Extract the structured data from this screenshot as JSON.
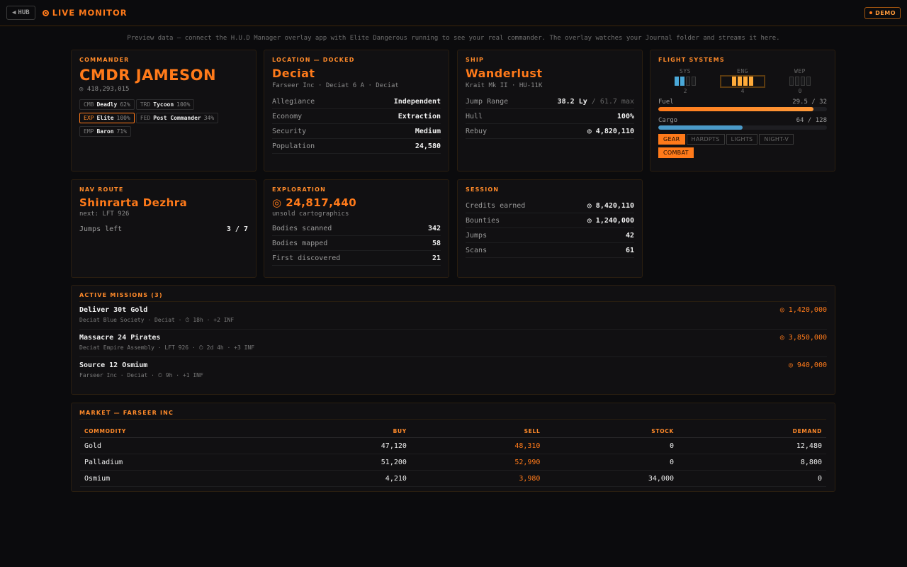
{
  "topbar": {
    "hub_label": "HUB",
    "live_label": "LIVE MONITOR",
    "demo_label": "DEMO"
  },
  "notice": "Preview data — connect the H.U.D Manager overlay app with Elite Dangerous running to see your real commander. The overlay watches your Journal folder and streams it here.",
  "commander": {
    "title": "COMMANDER",
    "name": "CMDR JAMESON",
    "credits": "◎ 418,293,015",
    "ranks": [
      {
        "abbr": "CMB",
        "name": "Deadly",
        "pct": "62%",
        "highlight": false
      },
      {
        "abbr": "TRD",
        "name": "Tycoon",
        "pct": "100%",
        "highlight": false
      },
      {
        "abbr": "EXP",
        "name": "Elite",
        "pct": "100%",
        "highlight": true
      },
      {
        "abbr": "FED",
        "name": "Post Commander",
        "pct": "34%",
        "highlight": false
      },
      {
        "abbr": "EMP",
        "name": "Baron",
        "pct": "71%",
        "highlight": false
      }
    ]
  },
  "location": {
    "title": "LOCATION — DOCKED",
    "name": "Deciat",
    "sub": "Farseer Inc · Deciat 6 A · Deciat",
    "rows": [
      {
        "k": "Allegiance",
        "v": "Independent"
      },
      {
        "k": "Economy",
        "v": "Extraction"
      },
      {
        "k": "Security",
        "v": "Medium"
      },
      {
        "k": "Population",
        "v": "24,580"
      }
    ]
  },
  "ship": {
    "title": "SHIP",
    "name": "Wanderlust",
    "sub": "Krait Mk II · HU-11K",
    "jump_label": "Jump Range",
    "jump_value": "38.2 Ly",
    "jump_max": "/ 61.7 max",
    "hull_label": "Hull",
    "hull_value": "100%",
    "rebuy_label": "Rebuy",
    "rebuy_value": "◎ 4,820,110"
  },
  "flight": {
    "title": "FLIGHT SYSTEMS",
    "pips": [
      {
        "label": "SYS",
        "value": "2",
        "level": 2,
        "color": "#4aa8d8"
      },
      {
        "label": "ENG",
        "value": "4",
        "level": 4,
        "color": "#ffab3a"
      },
      {
        "label": "WEP",
        "value": "0",
        "level": 0,
        "color": "#555555"
      }
    ],
    "fuel_label": "Fuel",
    "fuel_value": "29.5 / 32",
    "fuel_fraction": 0.922,
    "cargo_label": "Cargo",
    "cargo_value": "64 / 128",
    "cargo_fraction": 0.5,
    "toggles": [
      {
        "label": "GEAR",
        "on": true
      },
      {
        "label": "HARDPTS",
        "on": false
      },
      {
        "label": "LIGHTS",
        "on": false
      },
      {
        "label": "NIGHT-V",
        "on": false
      },
      {
        "label": "COMBAT",
        "on": true
      }
    ]
  },
  "nav": {
    "title": "NAV ROUTE",
    "dest": "Shinrarta Dezhra",
    "next": "next: LFT 926",
    "jumps_label": "Jumps left",
    "jumps_value": "3 / 7"
  },
  "exploration": {
    "title": "EXPLORATION",
    "value": "◎ 24,817,440",
    "sub": "unsold cartographics",
    "rows": [
      {
        "k": "Bodies scanned",
        "v": "342"
      },
      {
        "k": "Bodies mapped",
        "v": "58"
      },
      {
        "k": "First discovered",
        "v": "21"
      }
    ]
  },
  "session": {
    "title": "SESSION",
    "rows": [
      {
        "k": "Credits earned",
        "v": "◎ 8,420,110"
      },
      {
        "k": "Bounties",
        "v": "◎ 1,240,000"
      },
      {
        "k": "Jumps",
        "v": "42"
      },
      {
        "k": "Scans",
        "v": "61"
      }
    ]
  },
  "missions": {
    "title": "ACTIVE MISSIONS (3)",
    "items": [
      {
        "name": "Deliver 30t Gold",
        "detail": "Deciat Blue Society · Deciat · ⏱ 18h · +2 INF",
        "reward": "◎ 1,420,000"
      },
      {
        "name": "Massacre 24 Pirates",
        "detail": "Deciat Empire Assembly · LFT 926 · ⏱ 2d 4h · +3 INF",
        "reward": "◎ 3,850,000"
      },
      {
        "name": "Source 12 Osmium",
        "detail": "Farseer Inc · Deciat · ⏱ 9h · +1 INF",
        "reward": "◎ 940,000"
      }
    ]
  },
  "market": {
    "title": "MARKET — FARSEER INC",
    "headers": [
      "COMMODITY",
      "BUY",
      "SELL",
      "STOCK",
      "DEMAND"
    ],
    "rows": [
      [
        "Gold",
        "47,120",
        "48,310",
        "0",
        "12,480"
      ],
      [
        "Palladium",
        "51,200",
        "52,990",
        "0",
        "8,800"
      ],
      [
        "Osmium",
        "4,210",
        "3,980",
        "34,000",
        "0"
      ]
    ]
  }
}
